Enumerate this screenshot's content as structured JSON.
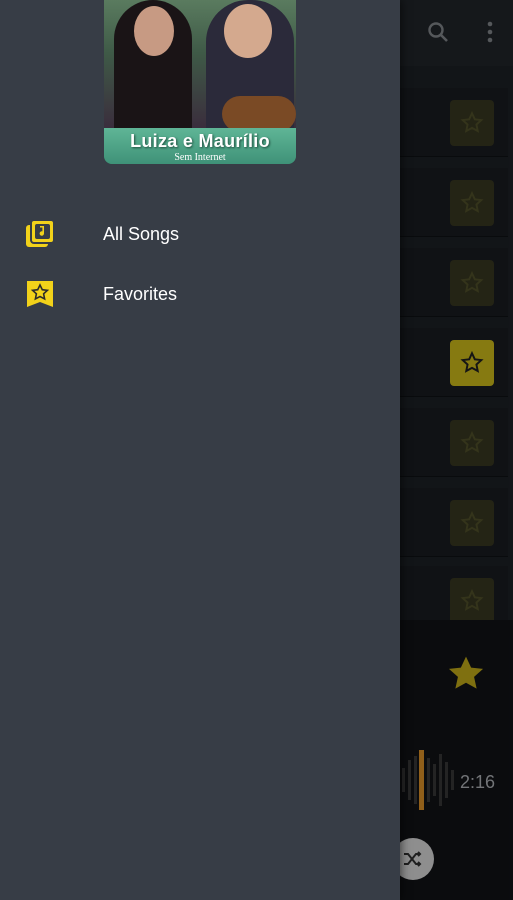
{
  "drawer": {
    "cover": {
      "title": "Luiza e Maurílio",
      "subtitle": "Sem Internet"
    },
    "items": [
      {
        "label": "All Songs",
        "icon": "music-library-icon"
      },
      {
        "label": "Favorites",
        "icon": "favorite-star-icon"
      }
    ]
  },
  "player": {
    "time": "2:16"
  },
  "colors": {
    "drawer_bg": "#373d46",
    "accent_yellow": "#f2d21a",
    "cover_band": "#4aa386",
    "progress_orange": "#e89a2a"
  }
}
